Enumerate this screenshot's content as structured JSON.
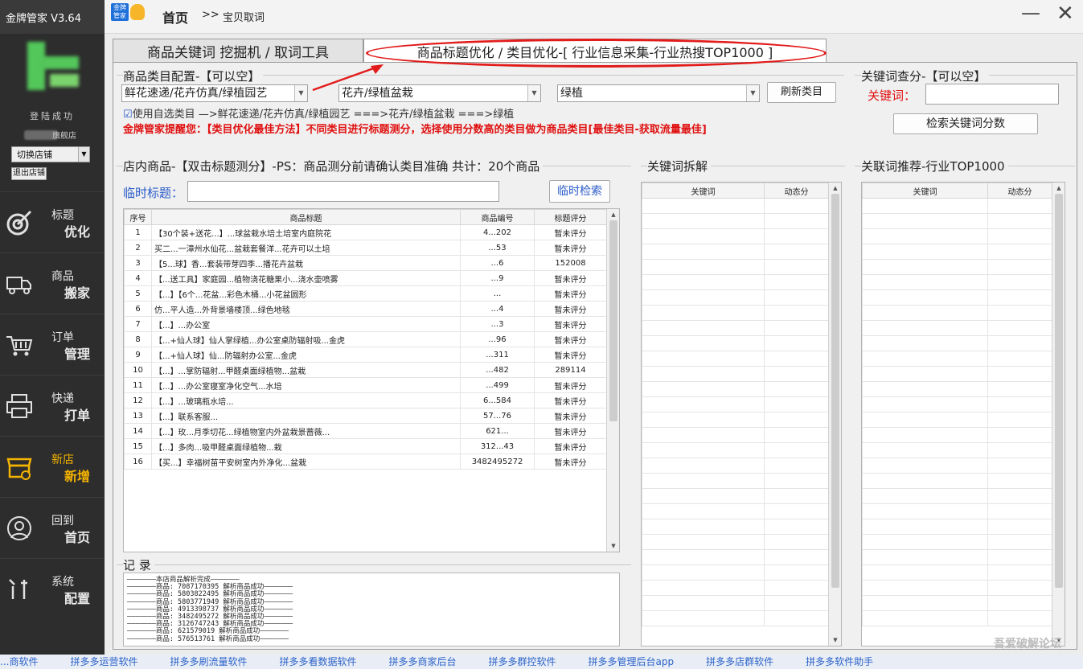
{
  "app": {
    "title": "金牌管家 V3.64",
    "logo_text": "金牌\n管家",
    "breadcrumb_home": "首页",
    "breadcrumb_sep": ">>",
    "breadcrumb_current": "宝贝取词",
    "minimize": "—",
    "close": "✕"
  },
  "sidebar": {
    "login_status": "登陆成功",
    "shop_name": "旗舰店",
    "switch_shop": "切换店铺",
    "logout": "退出店铺",
    "items": [
      {
        "l1": "标题",
        "l2": "优化",
        "icon": "target-arrow-icon"
      },
      {
        "l1": "商品",
        "l2": "搬家",
        "icon": "truck-icon"
      },
      {
        "l1": "订单",
        "l2": "管理",
        "icon": "cart-icon"
      },
      {
        "l1": "快递",
        "l2": "打单",
        "icon": "printer-icon"
      },
      {
        "l1": "新店",
        "l2": "新增",
        "icon": "store-icon"
      },
      {
        "l1": "回到",
        "l2": "首页",
        "icon": "home-people-icon"
      },
      {
        "l1": "系统",
        "l2": "配置",
        "icon": "settings-tools-icon"
      }
    ]
  },
  "tabs": {
    "keyword_tab": "商品关键词 挖掘机 / 取词工具",
    "title_tab": "商品标题优化 / 类目优化-[ 行业信息采集-行业热搜TOP1000 ]"
  },
  "category": {
    "group_title": "商品类目配置-【可以空】",
    "cat1": "鲜花速递/花卉仿真/绿植园艺",
    "cat2": "花卉/绿植盆栽",
    "cat3": "绿植",
    "refresh_button": "刷新类目",
    "use_custom_label": "使用自选类目 —>鲜花速递/花卉仿真/绿植园艺 ===>花卉/绿植盆栽 ===>绿植",
    "checkbox_mark": "☑",
    "tip": "金牌管家提醒您：【类目优化最佳方法】不同类目进行标题测分，选择使用分数高的类目做为商品类目[最佳类目-获取流量最佳]"
  },
  "keyword_score": {
    "group_title": "关键词查分-【可以空】",
    "label": "关键词：",
    "input_value": "",
    "search_button": "检索关键词分数"
  },
  "shop_goods": {
    "group_title": "店内商品-【双击标题测分】-PS：商品测分前请确认类目准确  共计：20个商品",
    "temp_title_label": "临时标题：",
    "temp_title_value": "",
    "temp_search_button": "临时检索",
    "columns": [
      "序号",
      "商品标题",
      "商品编号",
      "标题评分"
    ],
    "rows": [
      [
        "1",
        "【30个装+送花...】...球盆栽水培土培室内庭院花",
        "4...202",
        "暂未评分"
      ],
      [
        "2",
        "买二...一漳州水仙花...盆栽套餐洋...花卉可以土培",
        "...53",
        "暂未评分"
      ],
      [
        "3",
        "【5...球】香...套装带芽四季...播花卉盆栽",
        "...6",
        "152008"
      ],
      [
        "4",
        "【...送工具】家庭园...植物浇花糖果小...浇水壶喷雾",
        "...9",
        "暂未评分"
      ],
      [
        "5",
        "【...】【6个...花盆...彩色木桶...小花盆圆形",
        "...",
        "暂未评分"
      ],
      [
        "6",
        "仿...平人造...外背景墙楼顶...绿色地毯",
        "...4",
        "暂未评分"
      ],
      [
        "7",
        "【...】...办公室",
        "...3",
        "暂未评分"
      ],
      [
        "8",
        "【...+仙人球】仙人掌绿植...办公室桌防辐射吸...金虎",
        "...96",
        "暂未评分"
      ],
      [
        "9",
        "【...+仙人球】仙...防辐射办公室...金虎",
        "...311",
        "暂未评分"
      ],
      [
        "10",
        "【...】...掌防辐射...甲醛桌面绿植物...盆栽",
        "...482",
        "289114"
      ],
      [
        "11",
        "【...】...办公室寝室净化空气...水培",
        "...499",
        "暂未评分"
      ],
      [
        "12",
        "【...】...玻璃瓶水培...",
        "6...584",
        "暂未评分"
      ],
      [
        "13",
        "【...】联系客服...",
        "57...76",
        "暂未评分"
      ],
      [
        "14",
        "【...】玫...月季切花...绿植物室内外盆栽景蔷薇...",
        "621...",
        "暂未评分"
      ],
      [
        "15",
        "【...】多肉...吸甲醛桌面绿植物...栽",
        "312...43",
        "暂未评分"
      ],
      [
        "16",
        "【买...】幸福树苗平安树室内外净化...盆栽",
        "3482495272",
        "暂未评分"
      ]
    ]
  },
  "log": {
    "title": "记 录",
    "lines": [
      "———————本店商品解析完成———————",
      "———————商品: 7087170395 解析商品成功———————",
      "———————商品: 5803822495 解析商品成功———————",
      "———————商品: 5803771949 解析商品成功———————",
      "———————商品: 4913398737 解析商品成功———————",
      "———————商品: 3482495272 解析商品成功———————",
      "———————商品: 3126747243 解析商品成功———————",
      "———————商品: 621579019 解析商品成功———————",
      "———————商品: 576513761 解析商品成功———————"
    ]
  },
  "split": {
    "group_title": "关键词拆解",
    "columns": [
      "关键词",
      "动态分"
    ]
  },
  "recommend": {
    "group_title": "关联词推荐-行业TOP1000",
    "columns": [
      "关键词",
      "动态分"
    ]
  },
  "bottom_links": [
    "...商软件",
    "拼多多运营软件",
    "拼多多刷流量软件",
    "拼多多看数据软件",
    "拼多多商家后台",
    "拼多多群控软件",
    "拼多多管理后台app",
    "拼多多店群软件",
    "拼多多软件助手"
  ],
  "watermark": "吾爱破解论坛"
}
